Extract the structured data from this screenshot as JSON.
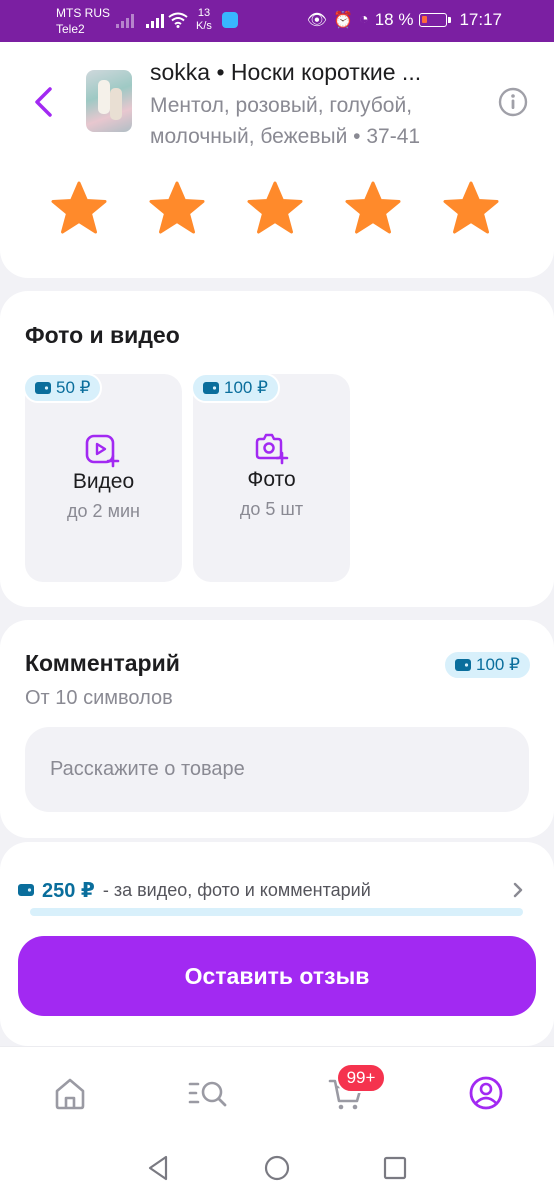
{
  "status_bar": {
    "carrier1": "MTS RUS",
    "carrier2": "Tele2",
    "speed_value": "13",
    "speed_unit": "K/s",
    "battery": "18 %",
    "time": "17:17"
  },
  "product": {
    "title": "sokka • Носки короткие ...",
    "subtitle": "Ментол, розовый, голубой, молочный, бежевый • 37-41"
  },
  "rating": {
    "stars": 5,
    "max": 5,
    "star_color": "#ff8a2b"
  },
  "media": {
    "title": "Фото и видео",
    "video": {
      "badge": "50 ₽",
      "label": "Видео",
      "sub": "до 2 мин"
    },
    "photo": {
      "badge": "100 ₽",
      "label": "Фото",
      "sub": "до 5 шт"
    }
  },
  "comment": {
    "title": "Комментарий",
    "sub": "От 10 символов",
    "badge": "100 ₽",
    "placeholder": "Расскажите о товаре"
  },
  "reward": {
    "amount": "250 ₽",
    "text": "- за видео, фото и комментарий",
    "progress": 0
  },
  "submit": {
    "label": "Оставить отзыв"
  },
  "tabbar": {
    "items": [
      "home-icon",
      "catalog-search-icon",
      "cart-icon",
      "profile-icon"
    ],
    "cart_badge": "99+"
  },
  "nav": {
    "items": [
      "back-triangle-icon",
      "home-circle-icon",
      "recents-square-icon"
    ]
  },
  "colors": {
    "accent": "#a229f2",
    "status_bar": "#7b1fa2",
    "badge_bg": "#d8f0fb",
    "badge_text": "#0a6e9c",
    "cart_badge": "#f5334e"
  }
}
